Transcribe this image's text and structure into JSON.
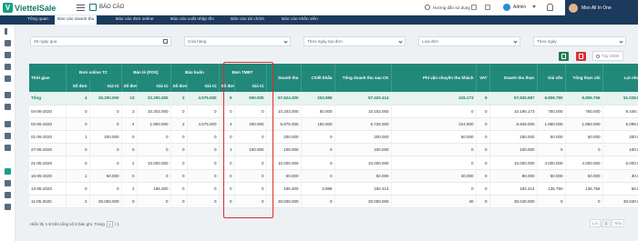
{
  "app": {
    "logo_text": "ViettelSale",
    "logo_letter": "V",
    "section_title": "BÁO CÁO"
  },
  "header": {
    "help_label": "Hướng dẫn sử dụng",
    "user_name": "Admin",
    "account_label": "Moo All In One"
  },
  "nav": {
    "items": [
      {
        "label": "Tổng quan"
      },
      {
        "label": "Báo cáo doanh thu"
      },
      {
        "label": "Báo cáo đơn online"
      },
      {
        "label": "Báo cáo xuất nhập tồn"
      },
      {
        "label": "Báo cáo tài chính"
      },
      {
        "label": "Báo cáo nhân viên"
      }
    ]
  },
  "filters": {
    "date_range": "28 ngày qua",
    "store": "Cửa hàng",
    "group_by_created": "Theo ngày tạo đơn",
    "order_type": "Loại đơn",
    "group_by": "Theo ngày"
  },
  "actions": {
    "customize_label": "Tùy chỉnh"
  },
  "table": {
    "group_headers": {
      "date": "Thời gian",
      "online": "Đơn online TC",
      "retail": "Bán lẻ (POS)",
      "wholesale": "Bán buôn",
      "ecom": "Đơn TMĐT",
      "revenue": "Doanh thu",
      "discount": "Chiết khấu",
      "total_after_discount": "Tổng doanh thu sau CK",
      "shipping_fee": "Phí vận chuyển thu khách",
      "vat": "VAT",
      "net_revenue": "Doanh thu thực",
      "cost": "Giá vốn",
      "total_spent": "Tổng thực chi",
      "profit": "Lợi nhuận"
    },
    "sub_headers": {
      "count": "Số đơn",
      "value": "Giá trị"
    },
    "rows": [
      [
        "Tổng",
        "4",
        "30.250.000",
        "13",
        "22.290.300",
        "2",
        "4.575.000",
        "5",
        "500.000",
        "57.624.300",
        "203.986",
        "57.420.414",
        "415.173",
        "9",
        "57.835.587",
        "6.806.750",
        "6.806.756",
        "51.028.831"
      ],
      [
        "04-06-2020",
        "0",
        "0",
        "3",
        "10.203.000",
        "0",
        "0",
        "0",
        "0",
        "10.203.000",
        "50.000",
        "10.153.000",
        "0",
        "0",
        "10.195.173",
        "750.000",
        "750.000",
        "9.449.173"
      ],
      [
        "02-06-2020",
        "0",
        "0",
        "4",
        "1.900.000",
        "2",
        "4.575.000",
        "4",
        "400.000",
        "6.875.000",
        "150.000",
        "6.725.000",
        "224.900",
        "0",
        "6.949.000",
        "1.850.000",
        "1.850.000",
        "5.099.000"
      ],
      [
        "01-06-2020",
        "1",
        "200.000",
        "0",
        "0",
        "0",
        "0",
        "0",
        "0",
        "200.000",
        "0",
        "200.000",
        "50.000",
        "0",
        "250.000",
        "50.000",
        "50.000",
        "200.000"
      ],
      [
        "27-05-2020",
        "0",
        "0",
        "0",
        "0",
        "0",
        "0",
        "1",
        "100.000",
        "100.000",
        "0",
        "100.000",
        "0",
        "0",
        "100.000",
        "0",
        "0",
        "100.000"
      ],
      [
        "21-05-2020",
        "0",
        "0",
        "2",
        "10.000.000",
        "0",
        "0",
        "0",
        "0",
        "10.000.000",
        "0",
        "10.000.000",
        "0",
        "0",
        "10.000.000",
        "4.000.000",
        "4.000.000",
        "6.000.000"
      ],
      [
        "15-05-2020",
        "1",
        "50.000",
        "0",
        "0",
        "0",
        "0",
        "0",
        "0",
        "50.000",
        "0",
        "50.000",
        "30.000",
        "0",
        "80.000",
        "50.000",
        "50.000",
        "30.000"
      ],
      [
        "13-05-2020",
        "0",
        "0",
        "2",
        "196.300",
        "0",
        "0",
        "0",
        "0",
        "196.300",
        "3.986",
        "192.414",
        "0",
        "0",
        "192.414",
        "136.750",
        "136.756",
        "55.670"
      ],
      [
        "11-05-2020",
        "2",
        "30.000.000",
        "0",
        "0",
        "0",
        "0",
        "0",
        "0",
        "30.000.000",
        "0",
        "30.000.000",
        "40",
        "0",
        "30.040.000",
        "0",
        "0",
        "30.040.000"
      ]
    ]
  },
  "footer": {
    "showing_text": "Hiển thị 1-8 trên tổng số 8 bản ghi. Trang",
    "page_current": "1",
    "page_total": "/ 1",
    "prev_label": "Lùi",
    "page_num": "1",
    "next_label": "Tiếp"
  },
  "colors": {
    "header_bg": "#1b3a5c",
    "table_header": "#21887a",
    "highlight_border": "#e22b2b",
    "accent": "#16a085"
  }
}
